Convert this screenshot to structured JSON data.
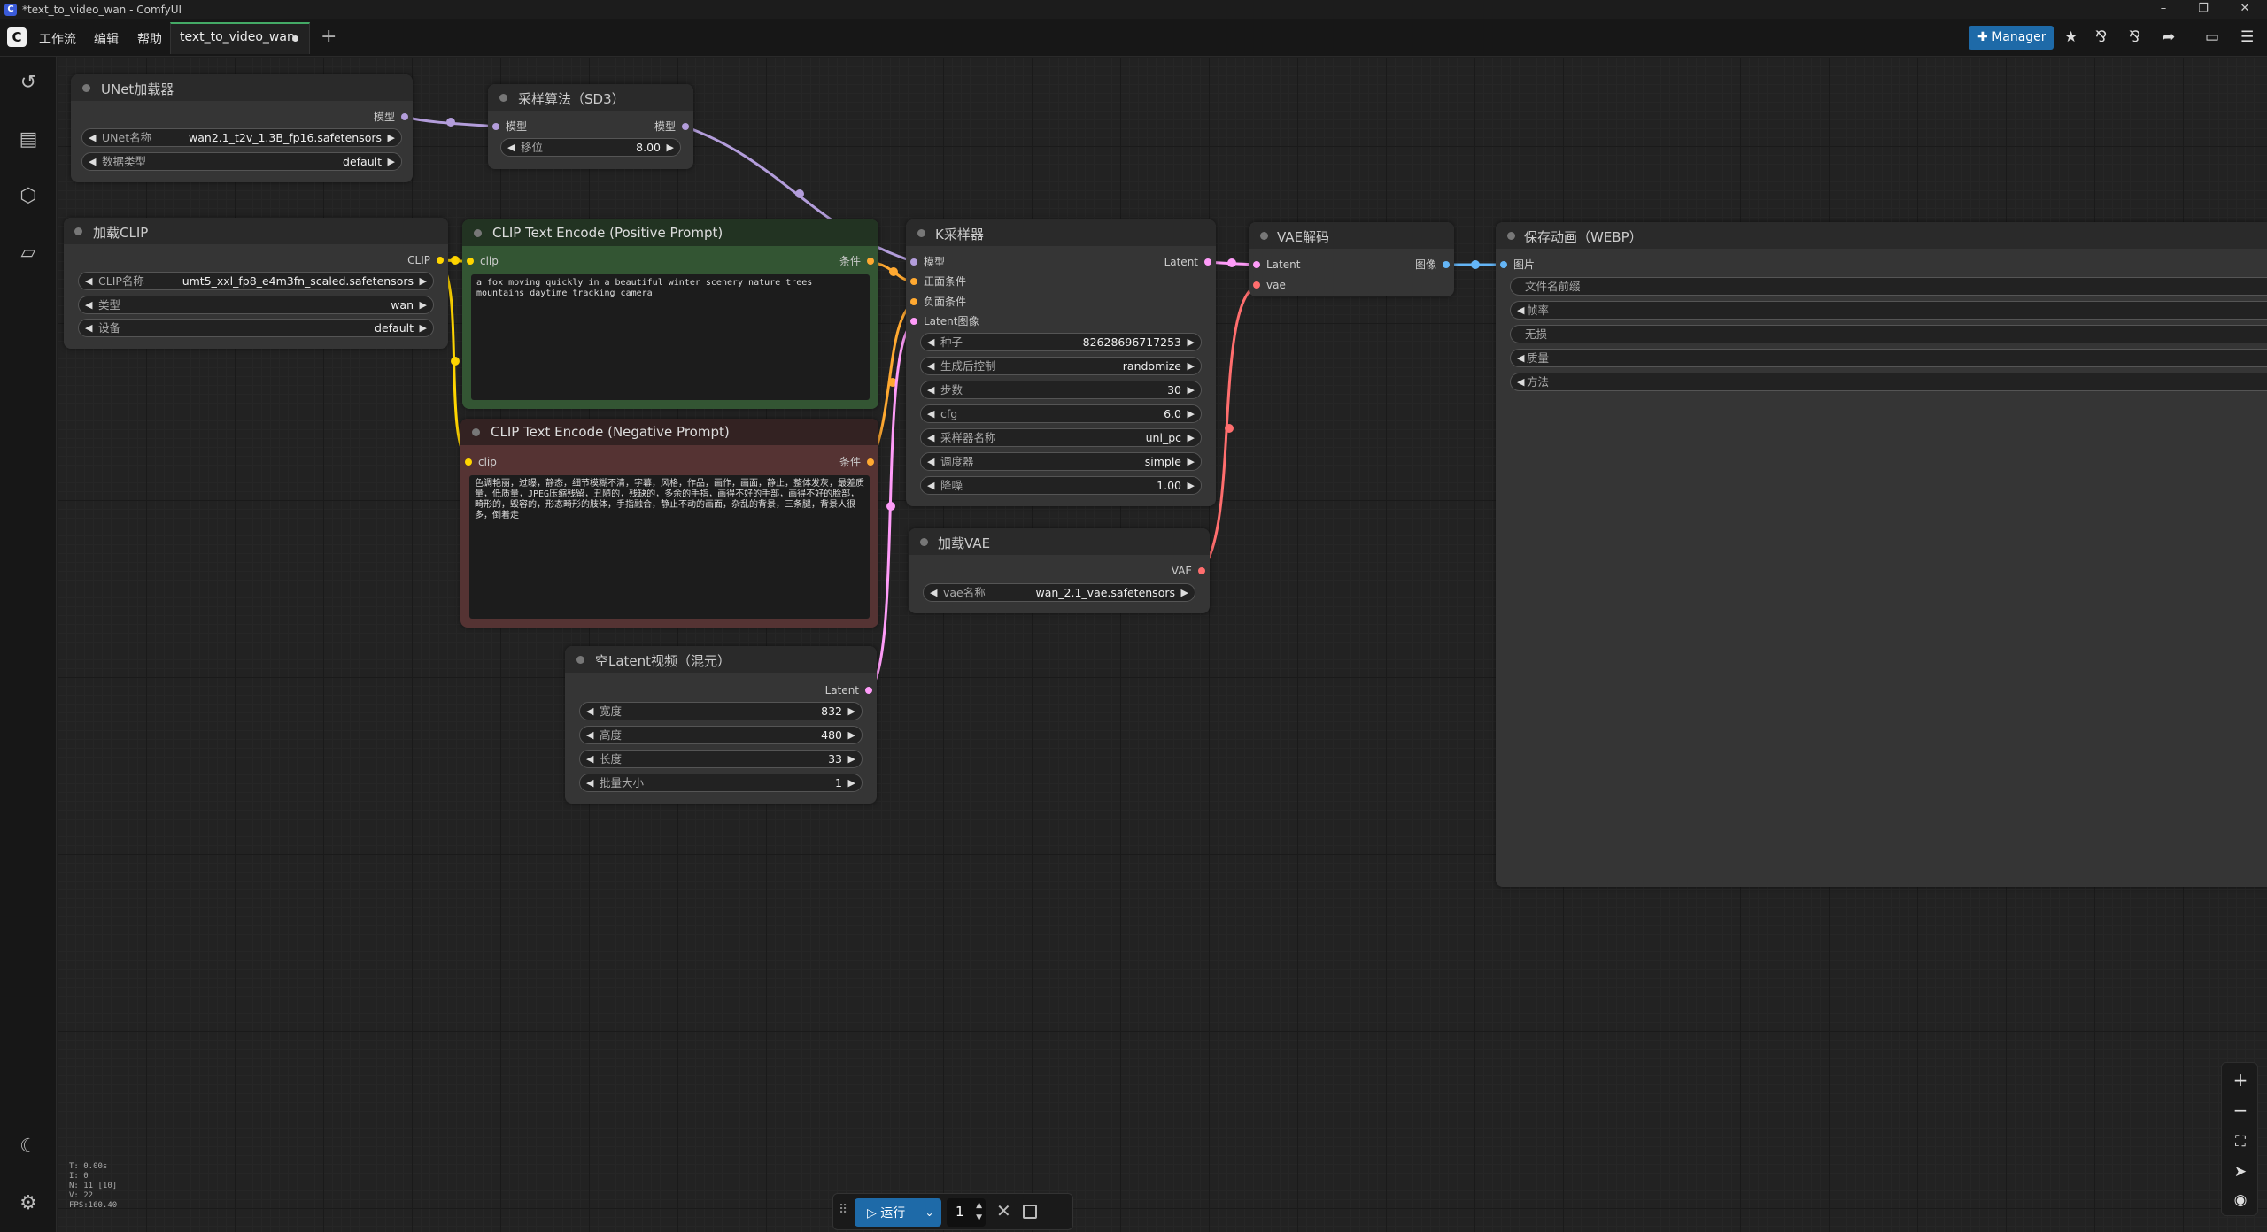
{
  "window": {
    "title": "*text_to_video_wan - ComfyUI",
    "minimize": "–",
    "maximize": "❐",
    "close": "✕"
  },
  "menu": {
    "workflow": "工作流",
    "edit": "编辑",
    "help": "帮助",
    "tab_label": "text_to_video_wan",
    "add_tab": "+",
    "manager": "Manager"
  },
  "nodes": {
    "unet_loader": {
      "title": "UNet加载器",
      "output": "模型",
      "unet_name_label": "UNet名称",
      "unet_name_value": "wan2.1_t2v_1.3B_fp16.safetensors",
      "dtype_label": "数据类型",
      "dtype_value": "default"
    },
    "sampling_sd3": {
      "title": "采样算法（SD3）",
      "input": "模型",
      "output": "模型",
      "shift_label": "移位",
      "shift_value": "8.00"
    },
    "load_clip": {
      "title": "加载CLIP",
      "output": "CLIP",
      "clip_name_label": "CLIP名称",
      "clip_name_value": "umt5_xxl_fp8_e4m3fn_scaled.safetensors",
      "type_label": "类型",
      "type_value": "wan",
      "device_label": "设备",
      "device_value": "default"
    },
    "clip_positive": {
      "title": "CLIP Text Encode (Positive Prompt)",
      "input": "clip",
      "output": "条件",
      "text": "a fox moving quickly in a beautiful winter scenery nature trees mountains daytime tracking camera"
    },
    "clip_negative": {
      "title": "CLIP Text Encode (Negative Prompt)",
      "input": "clip",
      "output": "条件",
      "text": "色调艳丽，过曝，静态，细节模糊不清，字幕，风格，作品，画作，画面，静止，整体发灰，最差质量，低质量，JPEG压缩残留，丑陋的，残缺的，多余的手指，画得不好的手部，画得不好的脸部，畸形的，毁容的，形态畸形的肢体，手指融合，静止不动的画面，杂乱的背景，三条腿，背景人很多，倒着走"
    },
    "empty_latent": {
      "title": "空Latent视频（混元）",
      "output": "Latent",
      "width_label": "宽度",
      "width_value": "832",
      "height_label": "高度",
      "height_value": "480",
      "length_label": "长度",
      "length_value": "33",
      "batch_label": "批量大小",
      "batch_value": "1"
    },
    "ksampler": {
      "title": "K采样器",
      "in_model": "模型",
      "in_positive": "正面条件",
      "in_negative": "负面条件",
      "in_latent": "Latent图像",
      "output": "Latent",
      "seed_label": "种子",
      "seed_value": "82628696717253",
      "control_label": "生成后控制",
      "control_value": "randomize",
      "steps_label": "步数",
      "steps_value": "30",
      "cfg_label": "cfg",
      "cfg_value": "6.0",
      "sampler_label": "采样器名称",
      "sampler_value": "uni_pc",
      "scheduler_label": "调度器",
      "scheduler_value": "simple",
      "denoise_label": "降噪",
      "denoise_value": "1.00"
    },
    "load_vae": {
      "title": "加载VAE",
      "output": "VAE",
      "vae_name_label": "vae名称",
      "vae_name_value": "wan_2.1_vae.safetensors"
    },
    "vae_decode": {
      "title": "VAE解码",
      "in_latent": "Latent",
      "in_vae": "vae",
      "output": "图像"
    },
    "save_webp": {
      "title": "保存动画（WEBP）",
      "input": "图片",
      "prefix_label": "文件名前缀",
      "fps_label": "帧率",
      "lossless_label": "无损",
      "quality_label": "质量",
      "method_label": "方法"
    }
  },
  "stats": {
    "t": "T: 0.00s",
    "i": "I: 0",
    "n": "N: 11 [10]",
    "v": "V: 22",
    "fps": "FPS:160.40"
  },
  "runbar": {
    "run_label": "运行",
    "count": "1"
  }
}
